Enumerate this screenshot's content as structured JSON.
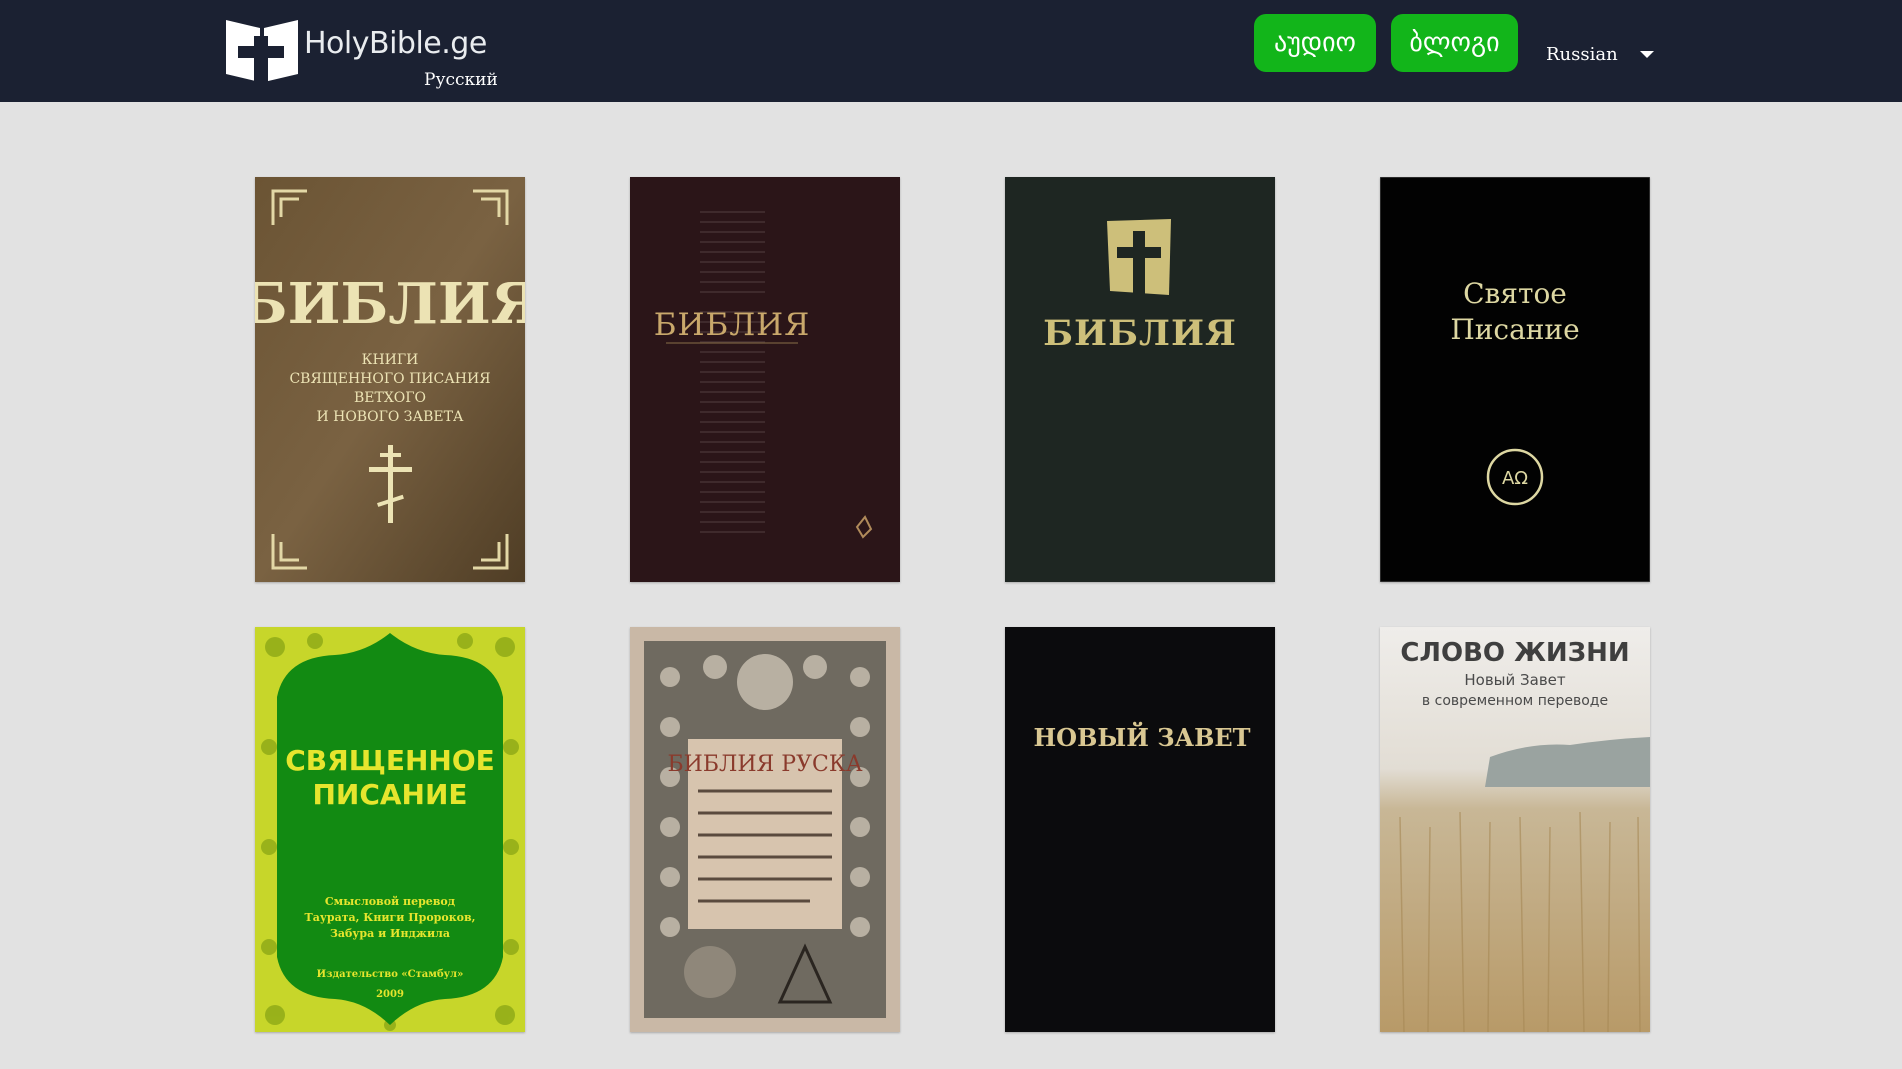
{
  "header": {
    "logo_text": "HolyBible.ge",
    "logo_subtitle": "Русский",
    "buttons": [
      {
        "label": "აუდიო"
      },
      {
        "label": "ბლოგი"
      }
    ],
    "language": {
      "selected": "Russian"
    }
  },
  "colors": {
    "navbar_bg": "#1b2132",
    "page_bg": "#e2e2e2",
    "button_green": "#12b51a"
  },
  "books": [
    {
      "lines": [
        "БИБЛИЯ",
        "КНИГИ",
        "СВЯЩЕННОГО ПИСАНИЯ",
        "ВЕТХОГО",
        "И НОВОГО ЗАВЕТА"
      ]
    },
    {
      "lines": [
        "БИБЛИЯ"
      ]
    },
    {
      "lines": [
        "БИБЛИЯ"
      ]
    },
    {
      "lines": [
        "Святое",
        "Писание",
        "AΩ"
      ]
    },
    {
      "lines": [
        "СВЯЩЕННОЕ",
        "ПИСАНИЕ",
        "Смысловой перевод",
        "Таурата, Книги Пророков,",
        "Забура и Инджила",
        "Издательство «Стамбул»",
        "2009"
      ]
    },
    {
      "lines": [
        "БИБЛИЯ РУСКА"
      ]
    },
    {
      "lines": [
        "НОВЫЙ ЗАВЕТ"
      ]
    },
    {
      "lines": [
        "СЛОВО ЖИЗНИ",
        "Новый Завет",
        "в современном переводе"
      ]
    }
  ]
}
